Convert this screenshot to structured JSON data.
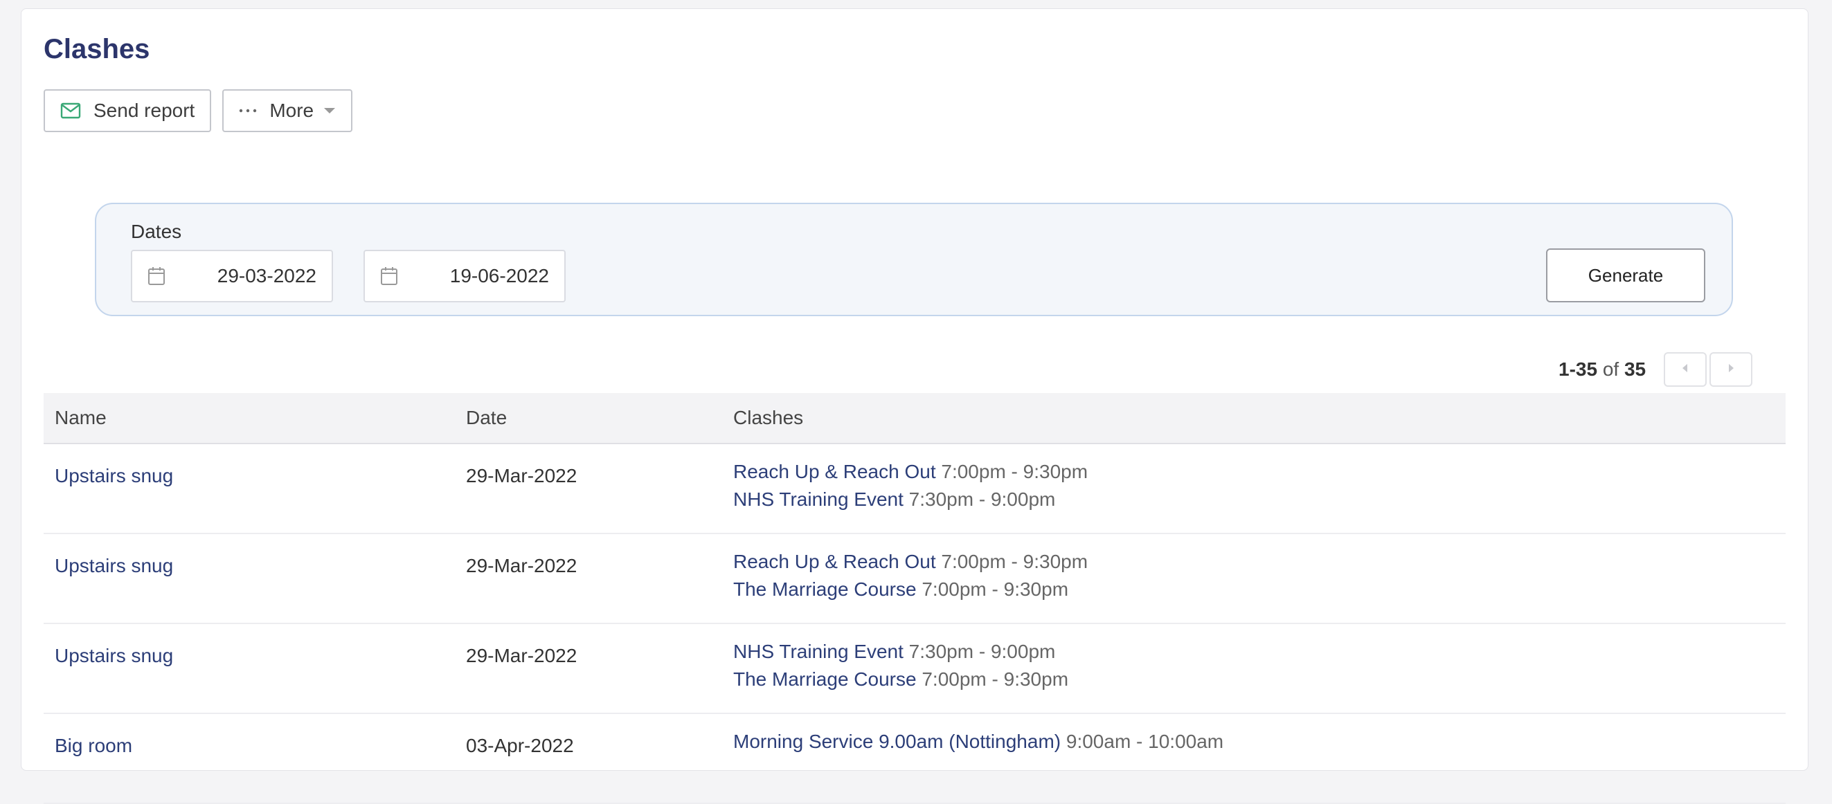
{
  "page": {
    "title": "Clashes"
  },
  "toolbar": {
    "send_report_label": "Send report",
    "more_label": "More"
  },
  "filters": {
    "dates_label": "Dates",
    "start_date": "29-03-2022",
    "end_date": "19-06-2022",
    "arrow": "→",
    "generate_label": "Generate"
  },
  "pager": {
    "range": "1-35",
    "of": "of",
    "total": "35"
  },
  "table": {
    "headers": {
      "name": "Name",
      "date": "Date",
      "clashes": "Clashes"
    },
    "rows": [
      {
        "name": "Upstairs snug",
        "date": "29-Mar-2022",
        "clashes": [
          {
            "event": "Reach Up & Reach Out",
            "time": "7:00pm - 9:30pm"
          },
          {
            "event": "NHS Training Event",
            "time": "7:30pm - 9:00pm"
          }
        ]
      },
      {
        "name": "Upstairs snug",
        "date": "29-Mar-2022",
        "clashes": [
          {
            "event": "Reach Up & Reach Out",
            "time": "7:00pm - 9:30pm"
          },
          {
            "event": "The Marriage Course",
            "time": "7:00pm - 9:30pm"
          }
        ]
      },
      {
        "name": "Upstairs snug",
        "date": "29-Mar-2022",
        "clashes": [
          {
            "event": "NHS Training Event",
            "time": "7:30pm - 9:00pm"
          },
          {
            "event": "The Marriage Course",
            "time": "7:00pm - 9:30pm"
          }
        ]
      },
      {
        "name": "Big room",
        "date": "03-Apr-2022",
        "clashes": [
          {
            "event": "Morning Service 9.00am (Nottingham)",
            "time": "9:00am - 10:00am"
          }
        ]
      }
    ]
  },
  "colors": {
    "title": "#2c356b",
    "link": "#2c3e78",
    "panel_bg": "#f3f6fa",
    "panel_border": "#c3d5ec",
    "mail_icon": "#3aa876"
  },
  "icons": {
    "send_report": "envelope-icon",
    "more": "ellipsis-icon",
    "more_caret": "caret-down-icon",
    "date": "calendar-icon",
    "pager_prev": "chevron-left-icon",
    "pager_next": "chevron-right-icon"
  }
}
